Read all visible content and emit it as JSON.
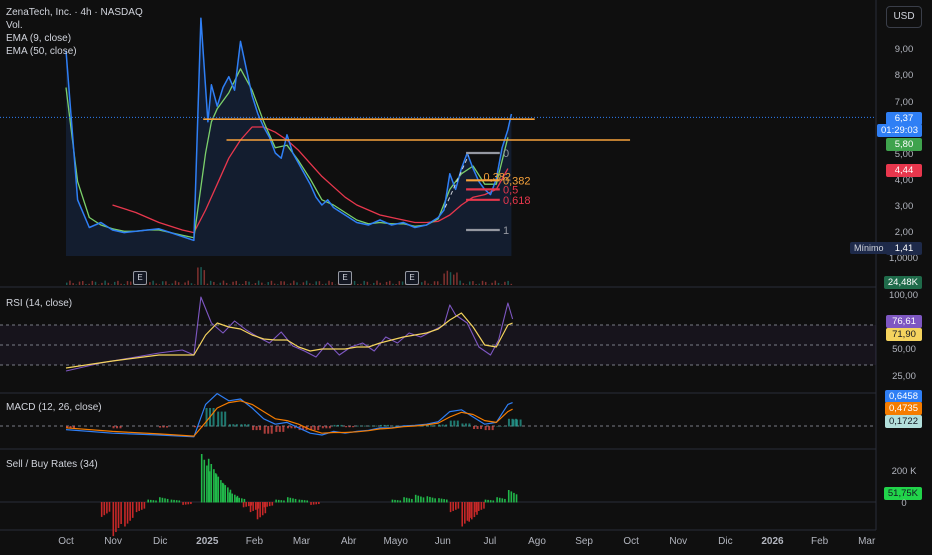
{
  "header": {
    "symbol_line": "ZenaTech, Inc. · 4h · NASDAQ",
    "indicators": [
      "Vol.",
      "EMA (9, close)",
      "EMA (50, close)"
    ],
    "currency_button": "USD"
  },
  "pane_labels": {
    "rsi": "RSI (14, close)",
    "macd": "MACD (12, 26, close)",
    "sellbuy": "Sell / Buy Rates (34)"
  },
  "colors": {
    "background": "#0f0f0f",
    "price_line": "#2f7ff5",
    "ema9": "#7bd06b",
    "ema50": "#e8374d",
    "fib_orange": "#f7a23b",
    "fib_red": "#e8374d",
    "fib_gray": "#9598a1",
    "rsi_line": "#7e57c2",
    "rsi_ma": "#f4d35e",
    "macd_line": "#2f7ff5",
    "signal_line": "#f57c00",
    "hist_up": "#26a69a",
    "hist_down": "#ef5350",
    "buy_bar": "#21b84a",
    "sell_bar": "#c62828"
  },
  "price_axis": {
    "labels": [
      "9,00",
      "8,00",
      "7,00",
      "5,00",
      "4,00",
      "3,00",
      "2,00",
      "1,0000"
    ],
    "last_price": "6,37",
    "countdown": "01:29:03",
    "ema9_value": "5,80",
    "ema50_value": "4,44",
    "minimo_label": "Mínimo",
    "minimo_value": "1,41",
    "volume_value": "24,48K"
  },
  "rsi_axis": {
    "labels": [
      "100,00",
      "50,00",
      "25,00"
    ],
    "rsi_value": "76,61",
    "ma_value": "71,90"
  },
  "macd_axis": {
    "macd_value": "0,6458",
    "signal_value": "0,4735",
    "hist_value": "0,1722"
  },
  "sellbuy_axis": {
    "labels": [
      "200 K",
      "0"
    ],
    "value": "51,75K"
  },
  "time_axis": [
    "Oct",
    "Nov",
    "Dic",
    "2025",
    "Feb",
    "Mar",
    "Abr",
    "Mayo",
    "Jun",
    "Jul",
    "Ago",
    "Sep",
    "Oct",
    "Nov",
    "Dic",
    "2026",
    "Feb",
    "Mar"
  ],
  "earnings_badge": "E",
  "fib_labels": [
    "0",
    "0,382",
    "0,5",
    "0,618",
    "1",
    "0,382"
  ],
  "chart_data": {
    "type": "line",
    "price": [
      [
        0,
        8.9
      ],
      [
        1,
        3.2
      ],
      [
        2,
        2.1
      ],
      [
        3,
        2.3
      ],
      [
        4,
        2.0
      ],
      [
        5,
        1.9
      ],
      [
        6,
        1.95
      ],
      [
        7,
        2.0
      ],
      [
        8,
        2.05
      ],
      [
        9,
        1.9
      ],
      [
        10,
        1.75
      ],
      [
        11,
        1.6
      ],
      [
        11.6,
        9.9
      ],
      [
        12.2,
        6.2
      ],
      [
        12.5,
        7.6
      ],
      [
        13,
        6.8
      ],
      [
        13.5,
        7.5
      ],
      [
        14,
        7.9
      ],
      [
        14.5,
        7.4
      ],
      [
        15,
        9.2
      ],
      [
        15.5,
        8.2
      ],
      [
        16,
        7.2
      ],
      [
        16.5,
        6.5
      ],
      [
        17,
        6.0
      ],
      [
        17.5,
        5.6
      ],
      [
        18,
        5.0
      ],
      [
        18.5,
        4.8
      ],
      [
        19,
        5.7
      ],
      [
        19.5,
        5.0
      ],
      [
        20,
        4.6
      ],
      [
        20.5,
        4.2
      ],
      [
        21,
        3.8
      ],
      [
        21.5,
        3.3
      ],
      [
        22,
        3.0
      ],
      [
        22.5,
        3.2
      ],
      [
        23,
        2.9
      ],
      [
        24,
        2.6
      ],
      [
        25,
        2.3
      ],
      [
        26,
        2.2
      ],
      [
        27,
        2.4
      ],
      [
        28,
        2.2
      ],
      [
        29,
        2.3
      ],
      [
        30,
        2.1
      ],
      [
        31,
        2.2
      ],
      [
        32,
        2.5
      ],
      [
        32.5,
        2.8
      ],
      [
        33,
        4.2
      ],
      [
        33.5,
        3.6
      ],
      [
        34,
        4.4
      ],
      [
        34.5,
        5.0
      ],
      [
        35,
        4.4
      ],
      [
        35.5,
        3.9
      ],
      [
        36,
        3.6
      ],
      [
        36.5,
        3.4
      ],
      [
        37,
        4.0
      ],
      [
        37.5,
        5.2
      ],
      [
        38,
        5.9
      ],
      [
        38.3,
        6.5
      ]
    ],
    "ema9": [
      [
        0,
        7.5
      ],
      [
        1,
        3.9
      ],
      [
        2,
        2.5
      ],
      [
        3,
        2.2
      ],
      [
        4,
        2.05
      ],
      [
        5,
        1.95
      ],
      [
        6,
        1.95
      ],
      [
        7,
        2.0
      ],
      [
        8,
        2.0
      ],
      [
        9,
        1.9
      ],
      [
        10,
        1.8
      ],
      [
        11,
        1.7
      ],
      [
        12,
        5.0
      ],
      [
        12.5,
        6.2
      ],
      [
        13,
        6.7
      ],
      [
        14,
        7.3
      ],
      [
        15,
        8.2
      ],
      [
        16,
        7.4
      ],
      [
        17,
        6.2
      ],
      [
        18,
        5.2
      ],
      [
        19,
        5.3
      ],
      [
        20,
        4.7
      ],
      [
        21,
        4.0
      ],
      [
        22,
        3.2
      ],
      [
        23,
        3.0
      ],
      [
        24,
        2.7
      ],
      [
        25,
        2.4
      ],
      [
        26,
        2.25
      ],
      [
        27,
        2.3
      ],
      [
        28,
        2.25
      ],
      [
        29,
        2.25
      ],
      [
        30,
        2.15
      ],
      [
        31,
        2.2
      ],
      [
        32,
        2.45
      ],
      [
        33,
        3.6
      ],
      [
        34,
        4.2
      ],
      [
        35,
        4.5
      ],
      [
        36,
        3.8
      ],
      [
        37,
        3.8
      ],
      [
        38,
        5.6
      ]
    ],
    "ema50": [
      [
        4,
        3.0
      ],
      [
        6,
        2.7
      ],
      [
        8,
        2.3
      ],
      [
        10,
        2.0
      ],
      [
        11,
        1.9
      ],
      [
        12,
        2.8
      ],
      [
        13,
        3.8
      ],
      [
        14,
        4.8
      ],
      [
        15,
        5.5
      ],
      [
        16,
        6.0
      ],
      [
        17,
        6.0
      ],
      [
        18,
        5.8
      ],
      [
        19,
        5.5
      ],
      [
        20,
        5.1
      ],
      [
        21,
        4.6
      ],
      [
        22,
        4.1
      ],
      [
        23,
        3.7
      ],
      [
        24,
        3.3
      ],
      [
        25,
        3.0
      ],
      [
        26,
        2.8
      ],
      [
        27,
        2.6
      ],
      [
        28,
        2.5
      ],
      [
        29,
        2.4
      ],
      [
        30,
        2.3
      ],
      [
        31,
        2.3
      ],
      [
        32,
        2.35
      ],
      [
        33,
        2.6
      ],
      [
        34,
        3.0
      ],
      [
        35,
        3.3
      ],
      [
        36,
        3.4
      ],
      [
        37,
        3.6
      ],
      [
        38,
        4.4
      ]
    ],
    "horizontal_levels": [
      {
        "price": 6.3,
        "from": 11.8,
        "to": 40.3,
        "color": "orange"
      },
      {
        "price": 5.5,
        "from": 13.8,
        "to": 48.5,
        "color": "orange"
      }
    ],
    "fib_levels": [
      {
        "label": "0",
        "price": 5.0,
        "color": "gray"
      },
      {
        "label": "0,382",
        "price": 3.95,
        "color": "orange"
      },
      {
        "label": "0,5",
        "price": 3.6,
        "color": "red"
      },
      {
        "label": "0,618",
        "price": 3.2,
        "color": "red"
      },
      {
        "label": "1",
        "price": 2.0,
        "color": "gray"
      }
    ],
    "rsi": [
      [
        0,
        24
      ],
      [
        3,
        32
      ],
      [
        6,
        38
      ],
      [
        8,
        42
      ],
      [
        10,
        45
      ],
      [
        11,
        40
      ],
      [
        11.6,
        98
      ],
      [
        12.5,
        72
      ],
      [
        13.5,
        62
      ],
      [
        14.5,
        74
      ],
      [
        15.5,
        65
      ],
      [
        16.5,
        58
      ],
      [
        17.5,
        52
      ],
      [
        18.5,
        63
      ],
      [
        19.5,
        49
      ],
      [
        20.5,
        44
      ],
      [
        21.5,
        38
      ],
      [
        22.5,
        52
      ],
      [
        23.5,
        40
      ],
      [
        24.5,
        48
      ],
      [
        25.5,
        52
      ],
      [
        26.5,
        44
      ],
      [
        27.5,
        58
      ],
      [
        28.5,
        52
      ],
      [
        29.5,
        62
      ],
      [
        30.5,
        58
      ],
      [
        31.5,
        64
      ],
      [
        32.5,
        70
      ],
      [
        33,
        90
      ],
      [
        33.5,
        80
      ],
      [
        34.5,
        72
      ],
      [
        35.5,
        48
      ],
      [
        36.5,
        40
      ],
      [
        37.2,
        55
      ],
      [
        38,
        92
      ],
      [
        38.4,
        76
      ]
    ],
    "rsi_ma": [
      [
        0,
        27
      ],
      [
        4,
        34
      ],
      [
        8,
        40
      ],
      [
        11,
        40
      ],
      [
        12,
        60
      ],
      [
        13,
        72
      ],
      [
        14,
        68
      ],
      [
        15,
        66
      ],
      [
        16,
        60
      ],
      [
        17,
        56
      ],
      [
        18,
        55
      ],
      [
        19,
        55
      ],
      [
        20,
        48
      ],
      [
        21,
        44
      ],
      [
        22,
        46
      ],
      [
        23,
        46
      ],
      [
        24,
        46
      ],
      [
        25,
        48
      ],
      [
        26,
        48
      ],
      [
        27,
        52
      ],
      [
        28,
        55
      ],
      [
        29,
        58
      ],
      [
        30,
        60
      ],
      [
        31,
        62
      ],
      [
        32,
        66
      ],
      [
        33,
        75
      ],
      [
        34,
        82
      ],
      [
        35,
        68
      ],
      [
        36,
        50
      ],
      [
        37,
        48
      ],
      [
        38,
        70
      ],
      [
        38.4,
        72
      ]
    ],
    "macd": [
      [
        0,
        -0.1
      ],
      [
        4,
        -0.2
      ],
      [
        8,
        -0.25
      ],
      [
        11,
        -0.3
      ],
      [
        12,
        0.6
      ],
      [
        13,
        0.9
      ],
      [
        14,
        0.7
      ],
      [
        15,
        0.75
      ],
      [
        16,
        0.5
      ],
      [
        17,
        0.2
      ],
      [
        18,
        0.05
      ],
      [
        19,
        0.1
      ],
      [
        20,
        -0.05
      ],
      [
        21,
        -0.2
      ],
      [
        22,
        -0.25
      ],
      [
        23,
        -0.15
      ],
      [
        24,
        -0.2
      ],
      [
        25,
        -0.15
      ],
      [
        26,
        -0.12
      ],
      [
        27,
        -0.05
      ],
      [
        28,
        -0.05
      ],
      [
        29,
        0.0
      ],
      [
        30,
        0.02
      ],
      [
        31,
        0.05
      ],
      [
        32,
        0.12
      ],
      [
        33,
        0.4
      ],
      [
        34,
        0.45
      ],
      [
        35,
        0.25
      ],
      [
        36,
        0.05
      ],
      [
        37,
        0.1
      ],
      [
        38,
        0.6
      ],
      [
        38.4,
        0.65
      ]
    ],
    "signal": [
      [
        0,
        -0.05
      ],
      [
        4,
        -0.15
      ],
      [
        8,
        -0.22
      ],
      [
        11,
        -0.28
      ],
      [
        12,
        0.1
      ],
      [
        13,
        0.5
      ],
      [
        14,
        0.65
      ],
      [
        15,
        0.7
      ],
      [
        16,
        0.6
      ],
      [
        17,
        0.4
      ],
      [
        18,
        0.2
      ],
      [
        19,
        0.15
      ],
      [
        20,
        0.05
      ],
      [
        21,
        -0.1
      ],
      [
        22,
        -0.2
      ],
      [
        23,
        -0.18
      ],
      [
        24,
        -0.18
      ],
      [
        25,
        -0.16
      ],
      [
        26,
        -0.13
      ],
      [
        27,
        -0.08
      ],
      [
        28,
        -0.06
      ],
      [
        29,
        -0.02
      ],
      [
        30,
        0.0
      ],
      [
        31,
        0.03
      ],
      [
        32,
        0.08
      ],
      [
        33,
        0.25
      ],
      [
        34,
        0.38
      ],
      [
        35,
        0.32
      ],
      [
        36,
        0.15
      ],
      [
        37,
        0.1
      ],
      [
        38,
        0.4
      ],
      [
        38.4,
        0.47
      ]
    ],
    "sellbuy": [
      [
        3,
        -0.3
      ],
      [
        4,
        -0.7
      ],
      [
        5,
        -0.5
      ],
      [
        6,
        -0.2
      ],
      [
        7,
        0.05
      ],
      [
        8,
        0.1
      ],
      [
        9,
        0.05
      ],
      [
        10,
        -0.05
      ],
      [
        11.6,
        1.0
      ],
      [
        12.2,
        0.9
      ],
      [
        12.8,
        0.6
      ],
      [
        13.4,
        0.4
      ],
      [
        14,
        0.2
      ],
      [
        14.6,
        0.1
      ],
      [
        15.2,
        -0.1
      ],
      [
        15.8,
        -0.2
      ],
      [
        16.4,
        -0.35
      ],
      [
        17,
        -0.1
      ],
      [
        18,
        0.05
      ],
      [
        19,
        0.1
      ],
      [
        20,
        0.05
      ],
      [
        21,
        -0.05
      ],
      [
        28,
        0.05
      ],
      [
        29,
        0.1
      ],
      [
        30,
        0.15
      ],
      [
        31,
        0.12
      ],
      [
        32,
        0.08
      ],
      [
        33,
        -0.2
      ],
      [
        34,
        -0.5
      ],
      [
        34.6,
        -0.4
      ],
      [
        35.2,
        -0.2
      ],
      [
        36,
        0.05
      ],
      [
        37,
        0.1
      ],
      [
        38,
        0.25
      ]
    ]
  }
}
